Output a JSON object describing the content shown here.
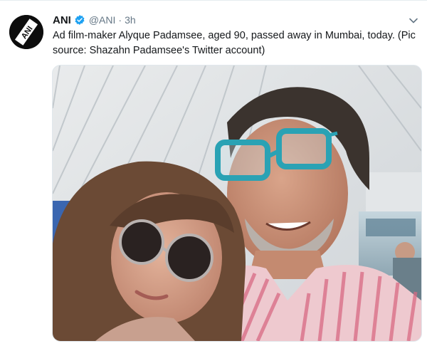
{
  "tweet": {
    "author_name": "ANI",
    "handle": "@ANI",
    "separator": "·",
    "time": "3h",
    "verified_icon": "verified-badge-icon",
    "avatar_logo_text": "ANI",
    "text": "Ad film-maker Alyque Padamsee, aged 90, passed away in Mumbai, today. (Pic source: Shazahn Padamsee's Twitter account)",
    "menu_icon": "chevron-down-icon",
    "media_alt": "Selfie of a woman in round sunglasses and an older man with blue glasses on an aircraft"
  },
  "colors": {
    "verified": "#1da1f2",
    "text": "#14171a",
    "muted": "#657786"
  }
}
